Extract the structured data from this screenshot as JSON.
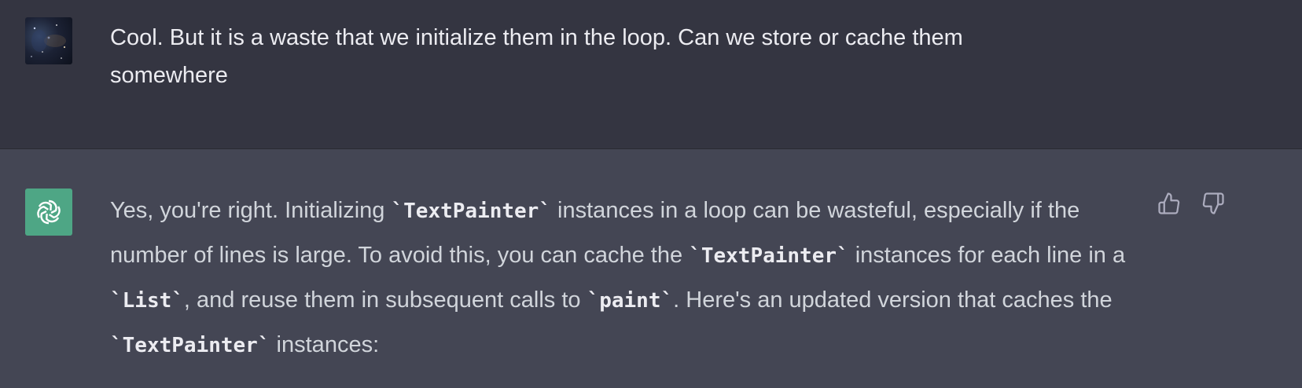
{
  "user_message": {
    "text": "Cool. But it is a waste that we initialize them in the loop. Can we store or cache them somewhere"
  },
  "assistant_message": {
    "segments": [
      {
        "type": "text",
        "value": "Yes, you're right. Initializing "
      },
      {
        "type": "code",
        "value": "`TextPainter`"
      },
      {
        "type": "text",
        "value": " instances in a loop can be wasteful, especially if the number of lines is large. To avoid this, you can cache the "
      },
      {
        "type": "code",
        "value": "`TextPainter`"
      },
      {
        "type": "text",
        "value": " instances for each line in a "
      },
      {
        "type": "code",
        "value": "`List`"
      },
      {
        "type": "text",
        "value": ", and reuse them in subsequent calls to "
      },
      {
        "type": "code",
        "value": "`paint`"
      },
      {
        "type": "text",
        "value": ". Here's an updated version that caches the "
      },
      {
        "type": "code",
        "value": "`TextPainter`"
      },
      {
        "type": "text",
        "value": " instances:"
      }
    ]
  },
  "icons": {
    "user_avatar": "user-avatar-image",
    "assistant_avatar": "openai-logo-icon",
    "thumbs_up": "thumbs-up-icon",
    "thumbs_down": "thumbs-down-icon"
  },
  "colors": {
    "user_bg": "#343541",
    "assistant_bg": "#444654",
    "assistant_avatar_bg": "#4ea685"
  }
}
